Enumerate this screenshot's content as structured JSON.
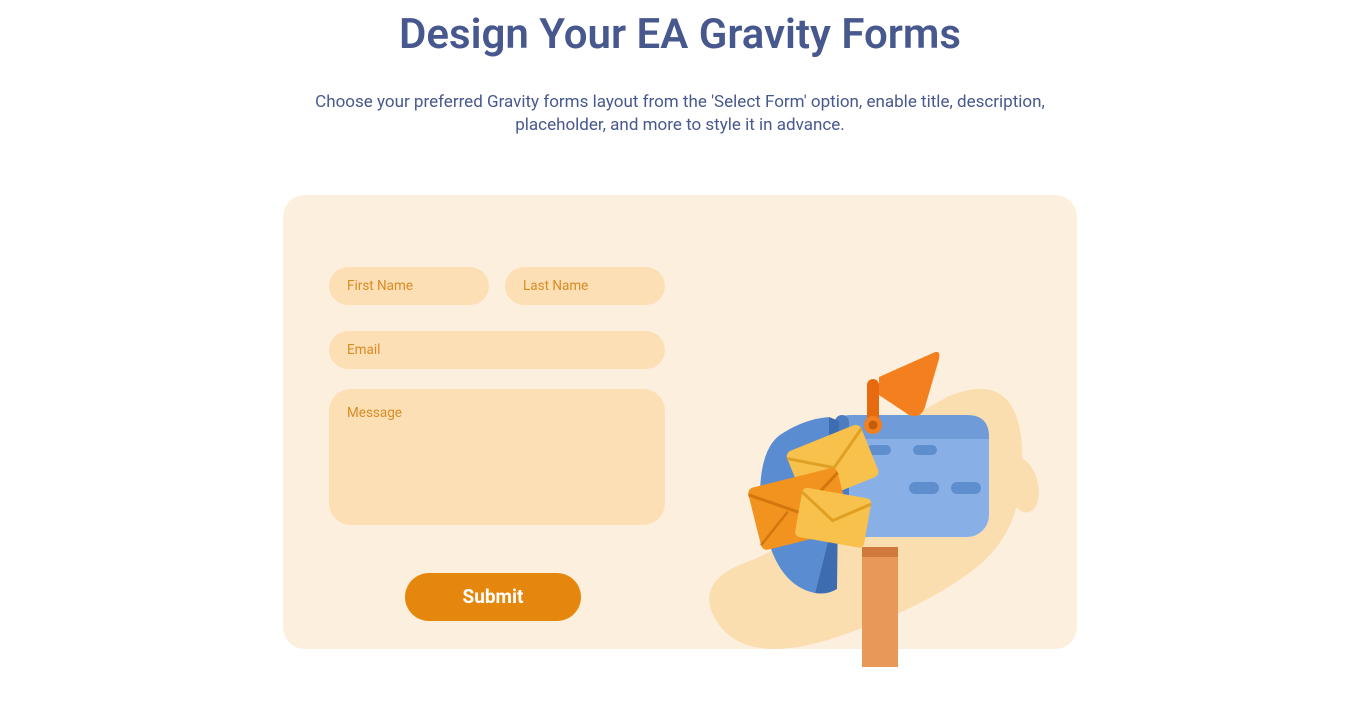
{
  "header": {
    "title": "Design Your EA Gravity Forms",
    "subtitle": "Choose your preferred Gravity forms layout from the 'Select Form' option, enable title, description, placeholder, and more to style it in advance."
  },
  "form": {
    "first_name_placeholder": "First Name",
    "last_name_placeholder": "Last Name",
    "email_placeholder": "Email",
    "message_placeholder": "Message",
    "submit_label": "Submit"
  }
}
